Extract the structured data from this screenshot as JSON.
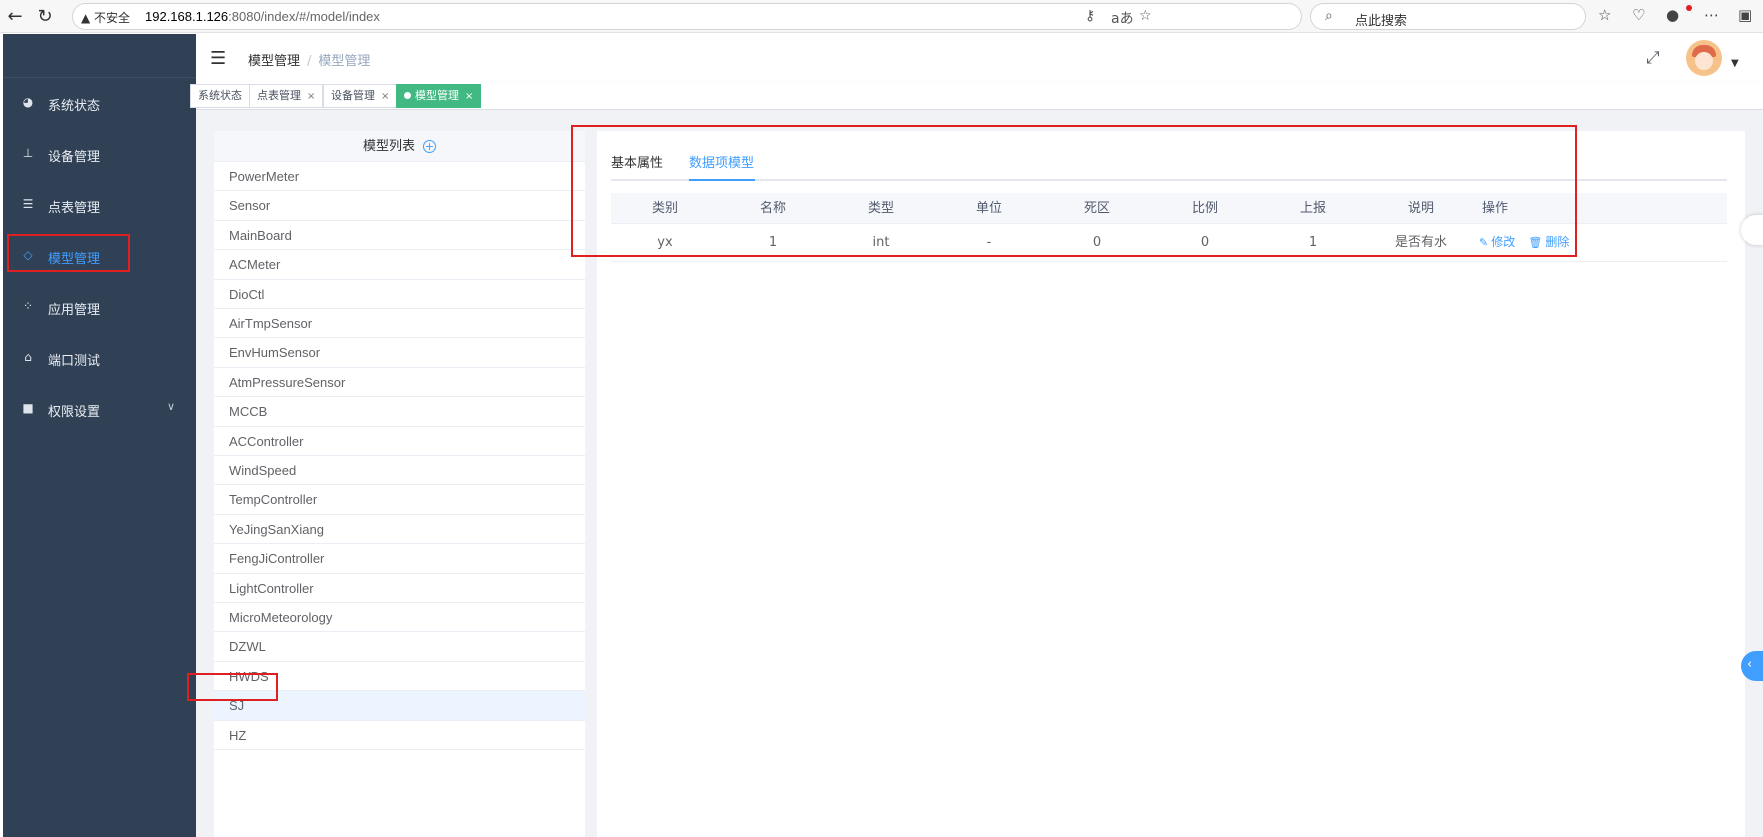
{
  "browser": {
    "insecure_label": "不安全",
    "url_host": "192.168.1.126",
    "url_path": ":8080/index/#/model/index",
    "search_placeholder": "点此搜索"
  },
  "sidebar": {
    "items": [
      {
        "label": "系统状态",
        "icon": "dashboard-icon"
      },
      {
        "label": "设备管理",
        "icon": "tree-icon"
      },
      {
        "label": "点表管理",
        "icon": "list-icon"
      },
      {
        "label": "模型管理",
        "icon": "cube-icon",
        "active": true
      },
      {
        "label": "应用管理",
        "icon": "apps-icon"
      },
      {
        "label": "端口测试",
        "icon": "port-icon"
      },
      {
        "label": "权限设置",
        "icon": "lock-icon",
        "expandable": true
      }
    ]
  },
  "header": {
    "breadcrumb": [
      "模型管理",
      "模型管理"
    ]
  },
  "tags": [
    {
      "label": "系统状态",
      "closable": false
    },
    {
      "label": "点表管理",
      "closable": true
    },
    {
      "label": "设备管理",
      "closable": true
    },
    {
      "label": "模型管理",
      "closable": true,
      "active": true
    }
  ],
  "model_list": {
    "title": "模型列表",
    "items": [
      "PowerMeter",
      "Sensor",
      "MainBoard",
      "ACMeter",
      "DioCtl",
      "AirTmpSensor",
      "EnvHumSensor",
      "AtmPressureSensor",
      "MCCB",
      "ACController",
      "WindSpeed",
      "TempController",
      "YeJingSanXiang",
      "FengJiController",
      "LightController",
      "MicroMeteorology",
      "DZWL",
      "HWDS",
      "SJ",
      "HZ"
    ],
    "selected": "SJ"
  },
  "detail": {
    "tabs": [
      "基本属性",
      "数据项模型"
    ],
    "active_tab": "数据项模型",
    "columns": [
      "类别",
      "名称",
      "类型",
      "单位",
      "死区",
      "比例",
      "上报",
      "说明",
      "操作"
    ],
    "rows": [
      {
        "category": "yx",
        "name": "1",
        "type": "int",
        "unit": "-",
        "deadband": "0",
        "ratio": "0",
        "report": "1",
        "description": "是否有水"
      }
    ],
    "actions": {
      "edit": "修改",
      "delete": "删除"
    }
  },
  "colors": {
    "sidebar_bg": "#304156",
    "accent": "#409eff",
    "active_tag": "#42b983",
    "highlight_box": "#e02020"
  }
}
